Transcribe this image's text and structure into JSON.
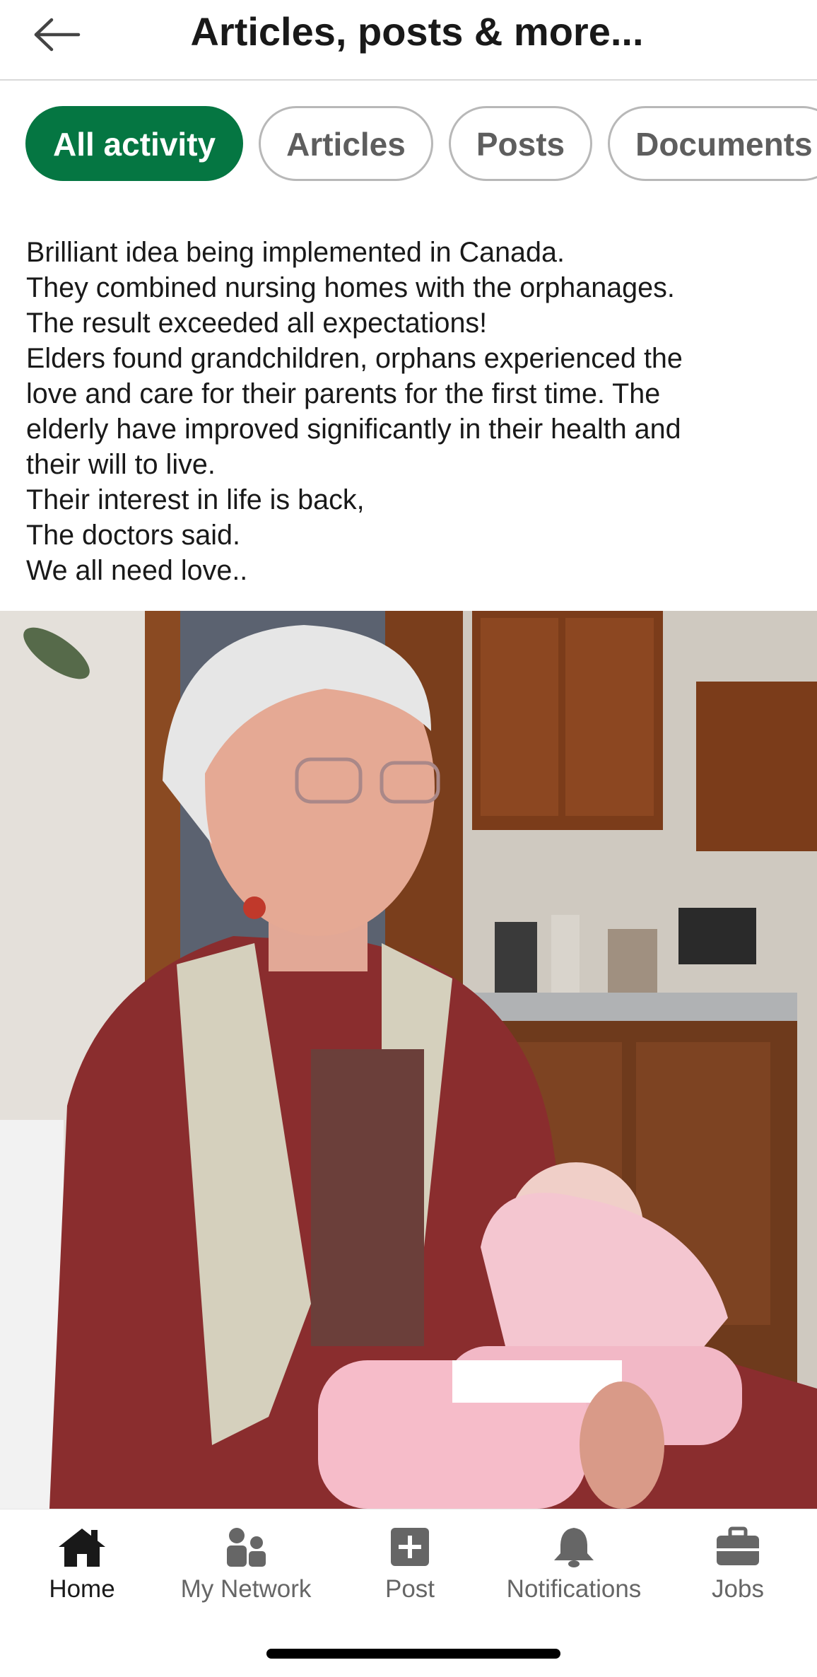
{
  "header": {
    "title": "Articles, posts & more...",
    "back_icon": "arrow-left-icon"
  },
  "filters": [
    {
      "label": "All activity",
      "active": true
    },
    {
      "label": "Articles",
      "active": false
    },
    {
      "label": "Posts",
      "active": false
    },
    {
      "label": "Documents",
      "active": false
    }
  ],
  "post": {
    "lines": [
      "Brilliant idea being implemented in Canada.",
      "They combined nursing homes with the orphanages.",
      "The result exceeded all expectations!",
      "Elders found grandchildren, orphans experienced the",
      "love and care for their parents for the first time. The",
      "elderly have improved significantly in their health and",
      "their will to live.",
      "Their interest in life is back,",
      "The doctors said.",
      "We all need love.."
    ]
  },
  "bottom_nav": [
    {
      "label": "Home",
      "icon": "home-icon",
      "active": true
    },
    {
      "label": "My Network",
      "icon": "network-icon",
      "active": false
    },
    {
      "label": "Post",
      "icon": "plus-square-icon",
      "active": false
    },
    {
      "label": "Notifications",
      "icon": "bell-icon",
      "active": false
    },
    {
      "label": "Jobs",
      "icon": "briefcase-icon",
      "active": false
    }
  ],
  "colors": {
    "accent": "#057642",
    "text": "#191919",
    "muted": "#666666"
  }
}
